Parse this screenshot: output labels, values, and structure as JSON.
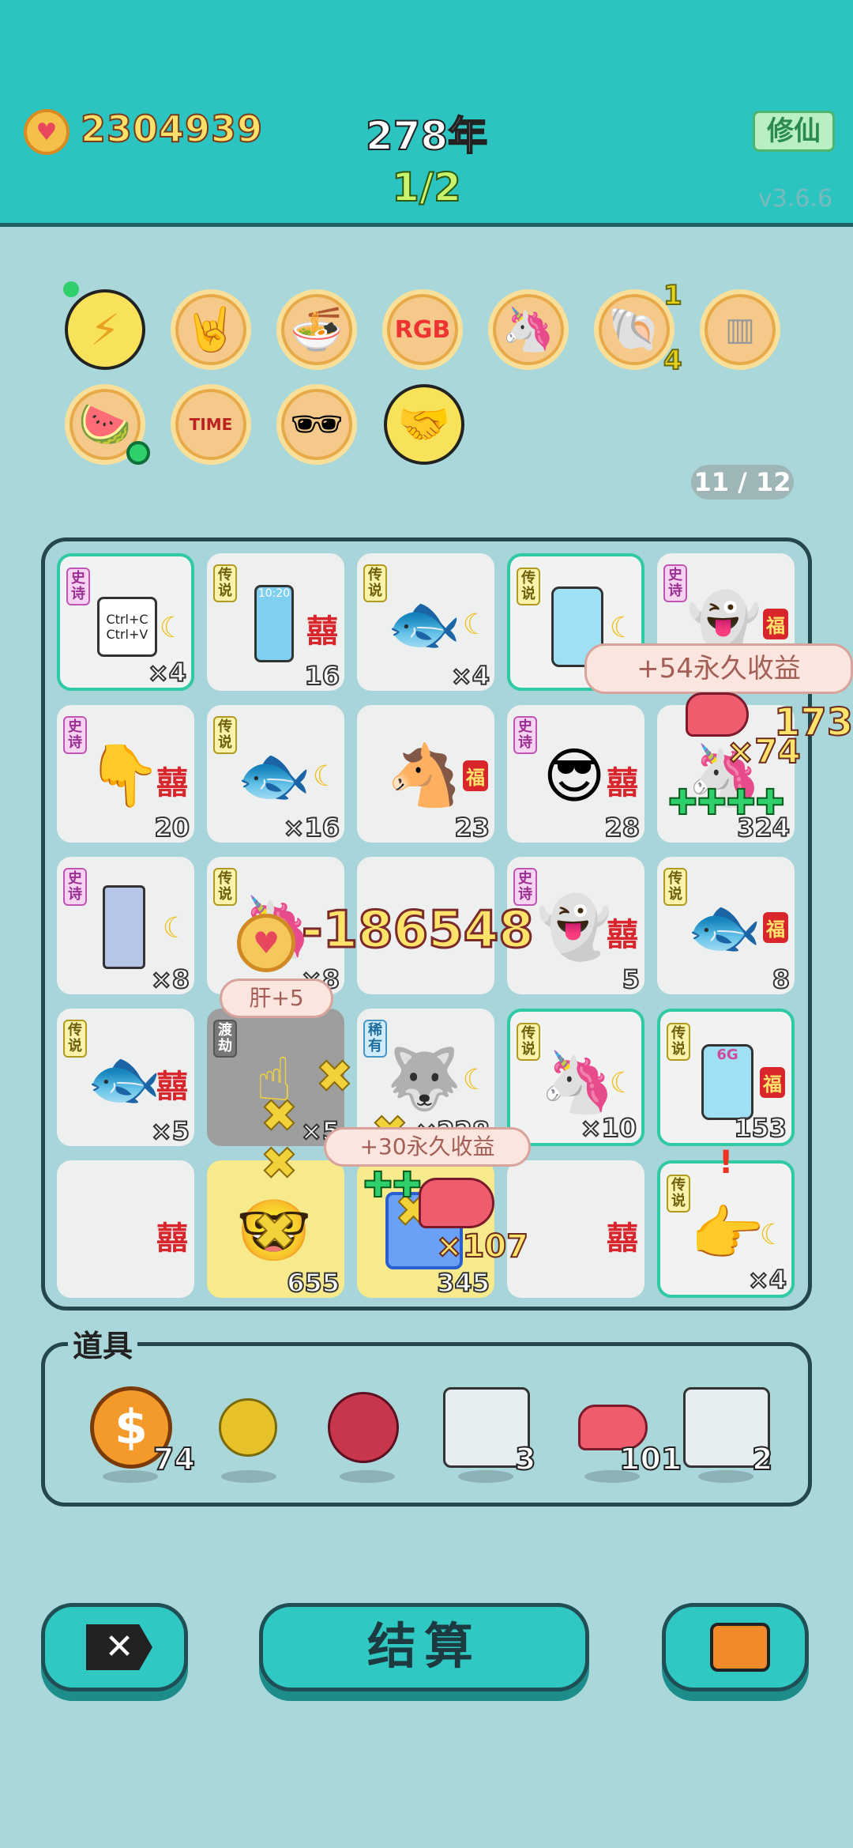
{
  "header": {
    "coins": "2304939",
    "year": "278年",
    "stage": "1/2",
    "cultivate_label": "修仙",
    "version": "v3.6.6"
  },
  "buffs": [
    {
      "icon": "lightning-icon"
    },
    {
      "icon": "rock-hand-icon"
    },
    {
      "icon": "noodle-bowl-icon"
    },
    {
      "icon": "rgb-icon",
      "text": "RGB"
    },
    {
      "icon": "unicorn-icon"
    },
    {
      "icon": "shell-icon",
      "top": "1",
      "bottom": "4"
    },
    {
      "icon": "skirt-icon"
    },
    {
      "icon": "fruit-plate-icon"
    },
    {
      "icon": "time-magazine-icon",
      "text": "TIME"
    },
    {
      "icon": "sunglasses-icon"
    },
    {
      "icon": "handshake-icon"
    }
  ],
  "page_indicator": "11 / 12",
  "tags": {
    "epic": "史诗",
    "legend": "传说",
    "rare": "稀有",
    "tribulation": "渡劫"
  },
  "board": {
    "row1": [
      {
        "icon": "copy-paste-card-icon",
        "icon_text": "Ctrl+C\nCtrl+V",
        "count": "×4"
      },
      {
        "icon": "phone-icon",
        "icon_text": "10:20",
        "count": "16"
      },
      {
        "icon": "koi-fish-icon",
        "count": "×4"
      },
      {
        "icon": "fridge-icon",
        "count": ""
      },
      {
        "icon": "ghost-icon",
        "count": ""
      }
    ],
    "row2": [
      {
        "icon": "pointing-hand-icon",
        "count": "20"
      },
      {
        "icon": "koi-fish-icon",
        "count": "×16"
      },
      {
        "icon": "horse-icon",
        "count": "23"
      },
      {
        "icon": "green-hat-man-icon",
        "count": "28"
      },
      {
        "icon": "unicorn-icon",
        "count": "324"
      }
    ],
    "row3": [
      {
        "icon": "gpu-card-icon",
        "count": "×8"
      },
      {
        "icon": "unicorn-icon",
        "count": "×8"
      },
      {
        "icon": "empty-icon",
        "count": ""
      },
      {
        "icon": "ghost-icon",
        "count": "5"
      },
      {
        "icon": "koi-fish-icon",
        "count": "8"
      }
    ],
    "row4": [
      {
        "icon": "koi-fish-icon",
        "count": "×5"
      },
      {
        "icon": "golden-hand-icon",
        "count": "×5"
      },
      {
        "icon": "husky-icon",
        "count": "×228"
      },
      {
        "icon": "unicorn-icon",
        "count": "×10"
      },
      {
        "icon": "fridge-6g-icon",
        "icon_text": "6G",
        "count": "153"
      }
    ],
    "row5": [
      {
        "icon": "empty-icon",
        "count": ""
      },
      {
        "icon": "glasses-man-icon",
        "count": "655"
      },
      {
        "icon": "bar-chart-icon",
        "count": "345"
      },
      {
        "icon": "empty-icon",
        "count": ""
      },
      {
        "icon": "golden-pointing-hand-icon",
        "count": "×4"
      }
    ]
  },
  "floats": {
    "permanent_income_1": "+54永久收益",
    "liver_count_1": "×74",
    "side_number": "173",
    "coin_delta": "-186548",
    "liver_plus": "肝+5",
    "permanent_income_2": "+30永久收益",
    "liver_count_2": "×107",
    "fu": "福",
    "xi": "囍"
  },
  "items": {
    "label": "道具",
    "list": [
      {
        "icon": "dollar-coin-icon",
        "count": "74"
      },
      {
        "icon": "gold-ball-icon",
        "count": ""
      },
      {
        "icon": "lychee-icon",
        "count": ""
      },
      {
        "icon": "rare-cards-icon",
        "count": "3"
      },
      {
        "icon": "liver-icon",
        "count": "101"
      },
      {
        "icon": "epic-cards-icon",
        "count": "2"
      }
    ]
  },
  "buttons": {
    "close": "close-icon",
    "settle": "结算",
    "bag": "briefcase-icon"
  },
  "colors": {
    "header_bg": "#2cc4c0",
    "body_bg": "#a9d7da",
    "button_bg": "#2fc8c3",
    "coin_text": "#fbe06a"
  }
}
